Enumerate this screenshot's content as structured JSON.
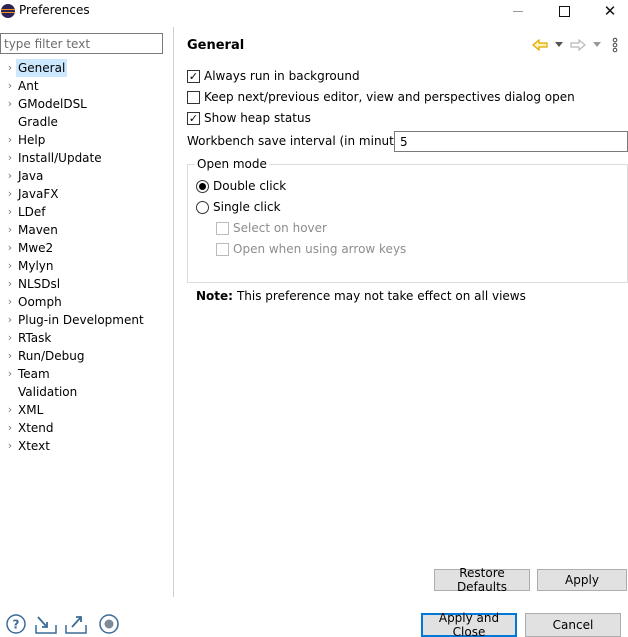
{
  "window": {
    "title": "Preferences",
    "minimize_label": "",
    "maximize_label": "",
    "close_glyph": "✕",
    "app_icon": "eclipse-icon"
  },
  "filter": {
    "placeholder": "type filter text",
    "value": ""
  },
  "tree": {
    "items": [
      {
        "label": "General",
        "expandable": true,
        "selected": true
      },
      {
        "label": "Ant",
        "expandable": true
      },
      {
        "label": "GModelDSL",
        "expandable": true
      },
      {
        "label": "Gradle",
        "expandable": false
      },
      {
        "label": "Help",
        "expandable": true
      },
      {
        "label": "Install/Update",
        "expandable": true
      },
      {
        "label": "Java",
        "expandable": true
      },
      {
        "label": "JavaFX",
        "expandable": true
      },
      {
        "label": "LDef",
        "expandable": true
      },
      {
        "label": "Maven",
        "expandable": true
      },
      {
        "label": "Mwe2",
        "expandable": true
      },
      {
        "label": "Mylyn",
        "expandable": true
      },
      {
        "label": "NLSDsl",
        "expandable": true
      },
      {
        "label": "Oomph",
        "expandable": true
      },
      {
        "label": "Plug-in Development",
        "expandable": true
      },
      {
        "label": "RTask",
        "expandable": true
      },
      {
        "label": "Run/Debug",
        "expandable": true
      },
      {
        "label": "Team",
        "expandable": true
      },
      {
        "label": "Validation",
        "expandable": false
      },
      {
        "label": "XML",
        "expandable": true
      },
      {
        "label": "Xtend",
        "expandable": true
      },
      {
        "label": "Xtext",
        "expandable": true
      }
    ]
  },
  "page": {
    "title": "General",
    "nav_icons": [
      "back-arrow-icon",
      "dropdown-icon",
      "forward-arrow-icon",
      "dropdown-icon",
      "view-menu-icon"
    ],
    "always_run_in_background": {
      "label": "Always run in background",
      "checked": true
    },
    "keep_next_previous": {
      "label": "Keep next/previous editor, view and perspectives dialog open",
      "checked": false
    },
    "show_heap_status": {
      "label": "Show heap status",
      "checked": true
    },
    "save_interval": {
      "label": "Workbench save interval (in minutes):",
      "value": "5"
    },
    "open_mode": {
      "label": "Open mode",
      "double_click": {
        "label": "Double click",
        "selected": true
      },
      "single_click": {
        "label": "Single click",
        "selected": false
      },
      "select_on_hover": {
        "label": "Select on hover",
        "checked": false,
        "enabled": false
      },
      "open_with_arrow_keys": {
        "label": "Open when using arrow keys",
        "checked": false,
        "enabled": false
      }
    },
    "note_prefix": "Note:",
    "note_text": "This preference may not take effect on all views"
  },
  "buttons": {
    "restore_defaults": "Restore Defaults",
    "apply": "Apply",
    "apply_and_close": "Apply and Close",
    "cancel": "Cancel"
  },
  "bottom_icons": [
    "help-icon",
    "import-icon",
    "export-icon",
    "record-icon"
  ],
  "colors": {
    "selection": "#cce8ff",
    "primary_border": "#0078d7",
    "nav_arrow": "#e8b100",
    "button_face": "#e1e1e1"
  }
}
